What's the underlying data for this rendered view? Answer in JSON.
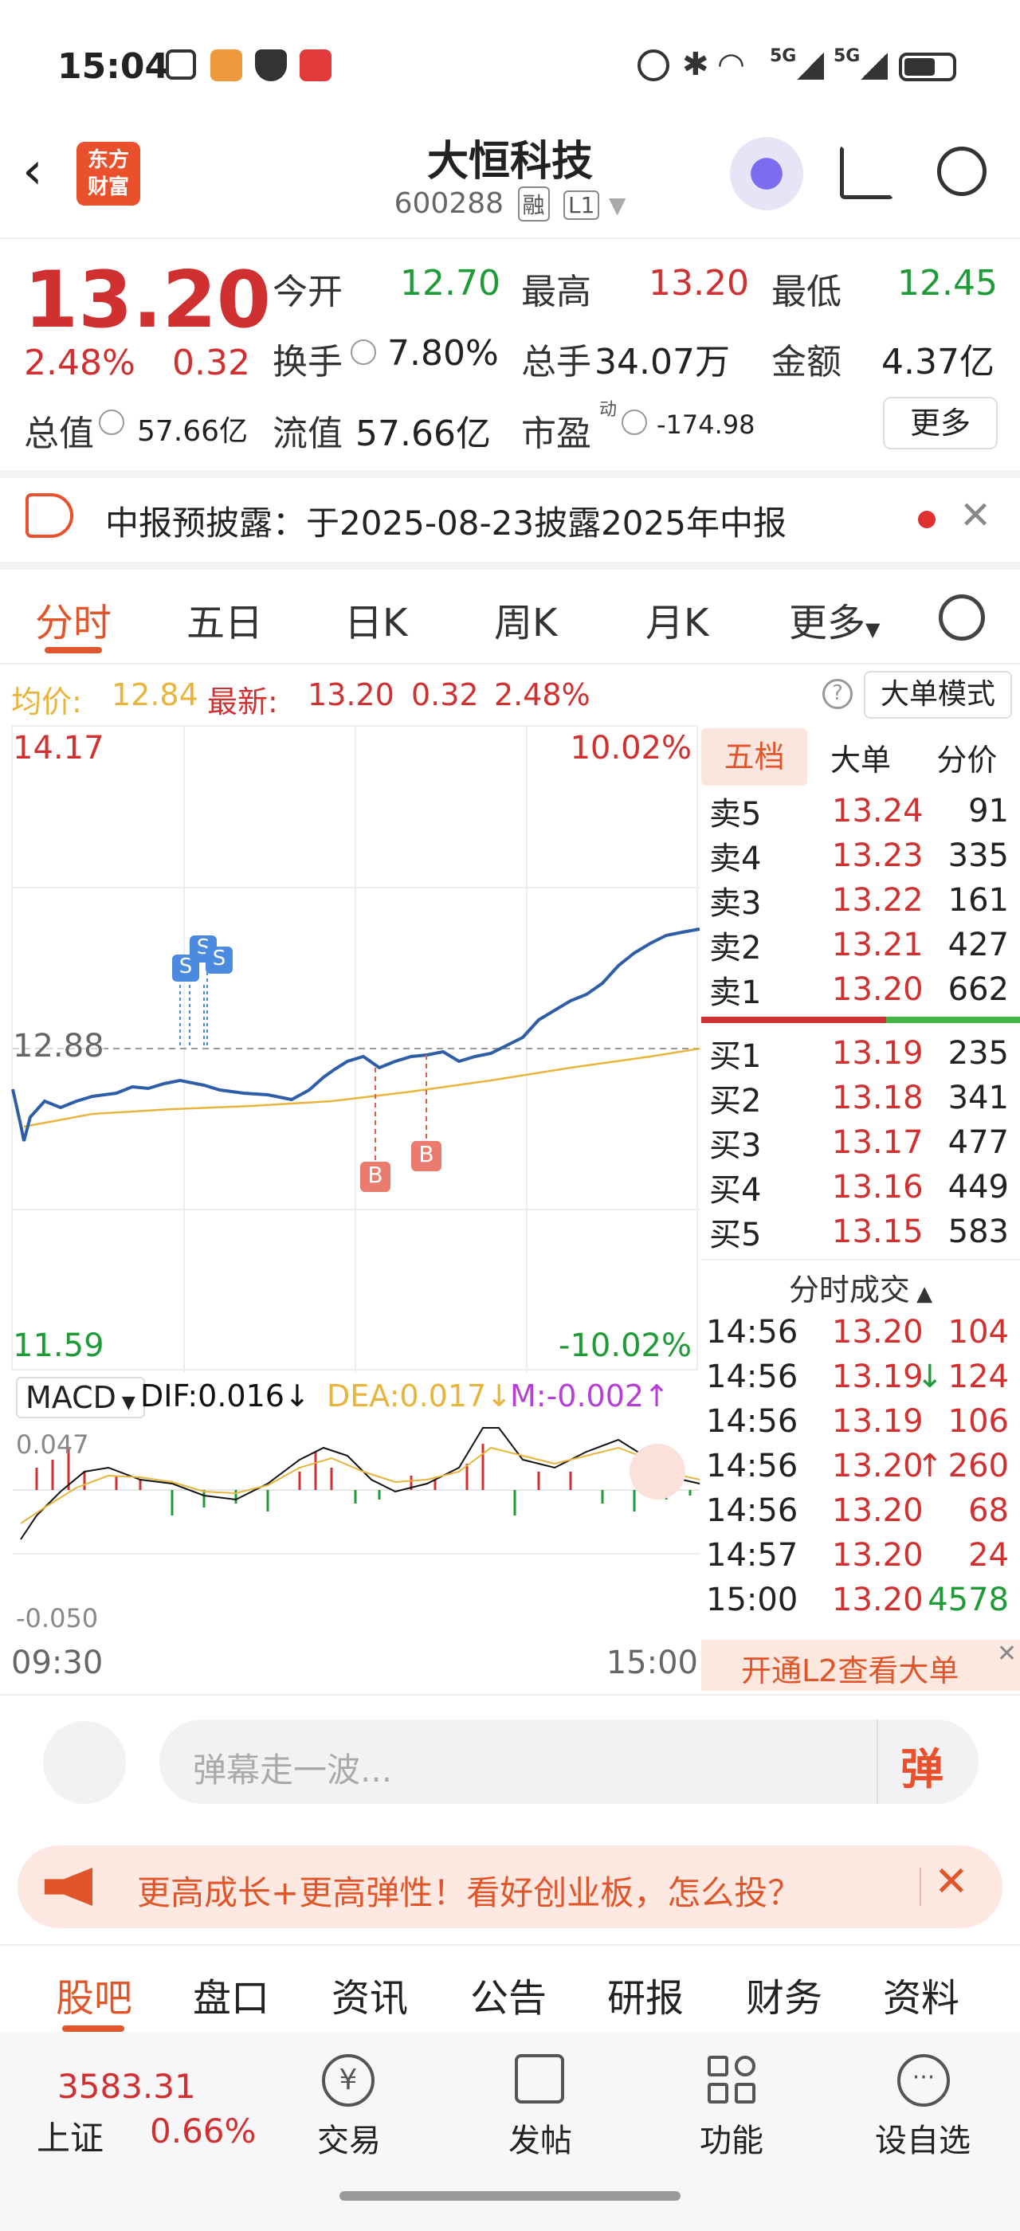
{
  "status": {
    "time": "15:04",
    "network1": "5G",
    "network2": "5G"
  },
  "header": {
    "title": "大恒科技",
    "code": "600288",
    "tag1": "融",
    "tag2": "L1",
    "logo_line1": "东方",
    "logo_line2": "财富"
  },
  "quote": {
    "price": "13.20",
    "pct": "2.48%",
    "chg": "0.32",
    "open_label": "今开",
    "open": "12.70",
    "high_label": "最高",
    "high": "13.20",
    "low_label": "最低",
    "low": "12.45",
    "turnover_label": "换手",
    "turnover": "7.80%",
    "volume_label": "总手",
    "volume": "34.07万",
    "amount_label": "金额",
    "amount": "4.37亿",
    "mktcap_label": "总值",
    "mktcap": "57.66亿",
    "float_label": "流值",
    "float": "57.66亿",
    "pe_label": "市盈",
    "pe_sup": "动",
    "pe": "-174.98",
    "more_button": "更多"
  },
  "notice": {
    "text": "中报预披露：于2025-08-23披露2025年中报"
  },
  "tabs": [
    "分时",
    "五日",
    "日K",
    "周K",
    "月K",
    "更多"
  ],
  "info_line": {
    "avg_label": "均价:",
    "avg": "12.84",
    "last_label": "最新:",
    "last": "13.20",
    "chg": "0.32",
    "pct": "2.48%",
    "mode_button": "大单模式"
  },
  "chart_labels": {
    "top_price": "14.17",
    "top_pct": "10.02%",
    "mid_price": "12.88",
    "bottom_price": "11.59",
    "bottom_pct": "-10.02%",
    "macd_select": "MACD",
    "dif": "DIF:0.016",
    "dea": "DEA:0.017",
    "m": "M:-0.002",
    "macd_top": "0.047",
    "macd_bottom": "-0.050",
    "time_start": "09:30",
    "time_end": "15:00",
    "marker_s": "S",
    "marker_b": "B"
  },
  "orderbook_tabs": [
    "五档",
    "大单",
    "分价"
  ],
  "asks": [
    {
      "label": "卖5",
      "price": "13.24",
      "vol": "91"
    },
    {
      "label": "卖4",
      "price": "13.23",
      "vol": "335"
    },
    {
      "label": "卖3",
      "price": "13.22",
      "vol": "161"
    },
    {
      "label": "卖2",
      "price": "13.21",
      "vol": "427"
    },
    {
      "label": "卖1",
      "price": "13.20",
      "vol": "662"
    }
  ],
  "bids": [
    {
      "label": "买1",
      "price": "13.19",
      "vol": "235"
    },
    {
      "label": "买2",
      "price": "13.18",
      "vol": "341"
    },
    {
      "label": "买3",
      "price": "13.17",
      "vol": "477"
    },
    {
      "label": "买4",
      "price": "13.16",
      "vol": "449"
    },
    {
      "label": "买5",
      "price": "13.15",
      "vol": "583"
    }
  ],
  "ticks_title": "分时成交",
  "ticks": [
    {
      "time": "14:56",
      "price": "13.20",
      "arrow": "",
      "vol": "104",
      "color": "red"
    },
    {
      "time": "14:56",
      "price": "13.19",
      "arrow": "↓",
      "vol": "124",
      "color": "red"
    },
    {
      "time": "14:56",
      "price": "13.19",
      "arrow": "",
      "vol": "106",
      "color": "red"
    },
    {
      "time": "14:56",
      "price": "13.20",
      "arrow": "↑",
      "vol": "260",
      "color": "red"
    },
    {
      "time": "14:56",
      "price": "13.20",
      "arrow": "",
      "vol": "68",
      "color": "red"
    },
    {
      "time": "14:57",
      "price": "13.20",
      "arrow": "",
      "vol": "24",
      "color": "red"
    },
    {
      "time": "15:00",
      "price": "13.20",
      "arrow": "",
      "vol": "4578",
      "color": "green"
    }
  ],
  "l2_banner": "开通L2查看大单",
  "comment": {
    "placeholder": "弹幕走一波...",
    "button": "弹"
  },
  "promo": {
    "text": "更高成长+更高弹性！看好创业板，怎么投？"
  },
  "section_tabs": [
    "股吧",
    "盘口",
    "资讯",
    "公告",
    "研报",
    "财务",
    "资料"
  ],
  "bottom_nav": {
    "index_value": "3583.31",
    "index_name": "上证",
    "index_pct": "0.66%",
    "items": [
      "交易",
      "发帖",
      "功能",
      "设自选"
    ]
  },
  "colors": {
    "red": "#d0302f",
    "green": "#1e9a37",
    "orange": "#e0562a",
    "blue_line": "#2f5ea8",
    "avg_line": "#e8b43c"
  }
}
